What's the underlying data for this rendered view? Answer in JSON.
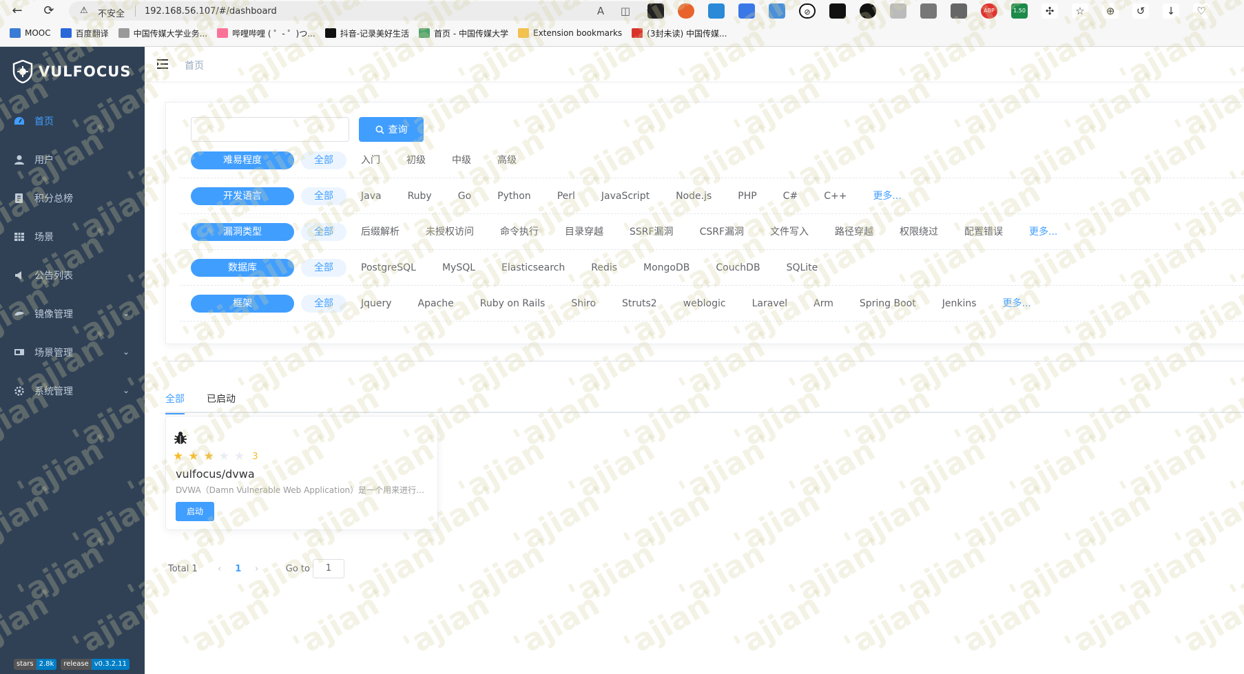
{
  "browser": {
    "insecure_label": "不安全",
    "url": "192.168.56.107/#/dashboard",
    "extension_badge": "1.50",
    "bookmarks": [
      {
        "label": "MOOC"
      },
      {
        "label": "百度翻译"
      },
      {
        "label": "中国传媒大学业务..."
      },
      {
        "label": "哔哩哔哩 ( ゜- ゜)つ..."
      },
      {
        "label": "抖音-记录美好生活"
      },
      {
        "label": "首页 - 中国传媒大学"
      },
      {
        "label": "Extension bookmarks"
      },
      {
        "label": "(3封未读) 中国传媒..."
      }
    ]
  },
  "sidebar": {
    "logo_text": "VULFOCUS",
    "items": [
      {
        "label": "首页",
        "icon": "dashboard-icon",
        "active": true
      },
      {
        "label": "用户",
        "icon": "user-icon"
      },
      {
        "label": "积分总榜",
        "icon": "leaderboard-icon"
      },
      {
        "label": "场景",
        "icon": "grid-icon"
      },
      {
        "label": "公告列表",
        "icon": "announcement-icon"
      },
      {
        "label": "镜像管理",
        "icon": "image-icon",
        "arrow": true
      },
      {
        "label": "场景管理",
        "icon": "scene-icon",
        "arrow": true
      },
      {
        "label": "系统管理",
        "icon": "settings-icon",
        "arrow": true
      }
    ],
    "badges": [
      {
        "key": "stars",
        "value": "2.8k"
      },
      {
        "key": "release",
        "value": "v0.3.2.11"
      }
    ]
  },
  "header": {
    "breadcrumb": "首页"
  },
  "search": {
    "placeholder": "",
    "button_label": "查询"
  },
  "filters": [
    {
      "label": "难易程度",
      "options": [
        "全部",
        "入门",
        "初级",
        "中级",
        "高级"
      ],
      "more": ""
    },
    {
      "label": "开发语言",
      "options": [
        "全部",
        "Java",
        "Ruby",
        "Go",
        "Python",
        "Perl",
        "JavaScript",
        "Node.js",
        "PHP",
        "C#",
        "C++"
      ],
      "more": "更多..."
    },
    {
      "label": "漏洞类型",
      "options": [
        "全部",
        "后缀解析",
        "未授权访问",
        "命令执行",
        "目录穿越",
        "SSRF漏洞",
        "CSRF漏洞",
        "文件写入",
        "路径穿越",
        "权限绕过",
        "配置错误"
      ],
      "more": "更多..."
    },
    {
      "label": "数据库",
      "options": [
        "全部",
        "PostgreSQL",
        "MySQL",
        "Elasticsearch",
        "Redis",
        "MongoDB",
        "CouchDB",
        "SQLite"
      ],
      "more": ""
    },
    {
      "label": "框架",
      "options": [
        "全部",
        "Jquery",
        "Apache",
        "Ruby on Rails",
        "Shiro",
        "Struts2",
        "weblogic",
        "Laravel",
        "Arm",
        "Spring Boot",
        "Jenkins"
      ],
      "more": "更多..."
    }
  ],
  "tabs": [
    {
      "label": "全部",
      "active": true
    },
    {
      "label": "已启动"
    }
  ],
  "vulns": [
    {
      "name": "vulfocus/dvwa",
      "rating": 3,
      "rating_max": 5,
      "score_label": "3",
      "description": "DVWA（Damn Vulnerable Web Application）是一个用来进行安全脆弱性鉴定的PHP/MySQL Web应用",
      "button_label": "启动"
    }
  ],
  "pagination": {
    "total_label": "Total 1",
    "current_page": "1",
    "goto_label": "Go to",
    "goto_value": "1"
  },
  "watermark_text": "'ajian'",
  "colors": {
    "sidebar_bg": "#304156",
    "accent": "#409eff",
    "star": "#f7ba2a"
  }
}
